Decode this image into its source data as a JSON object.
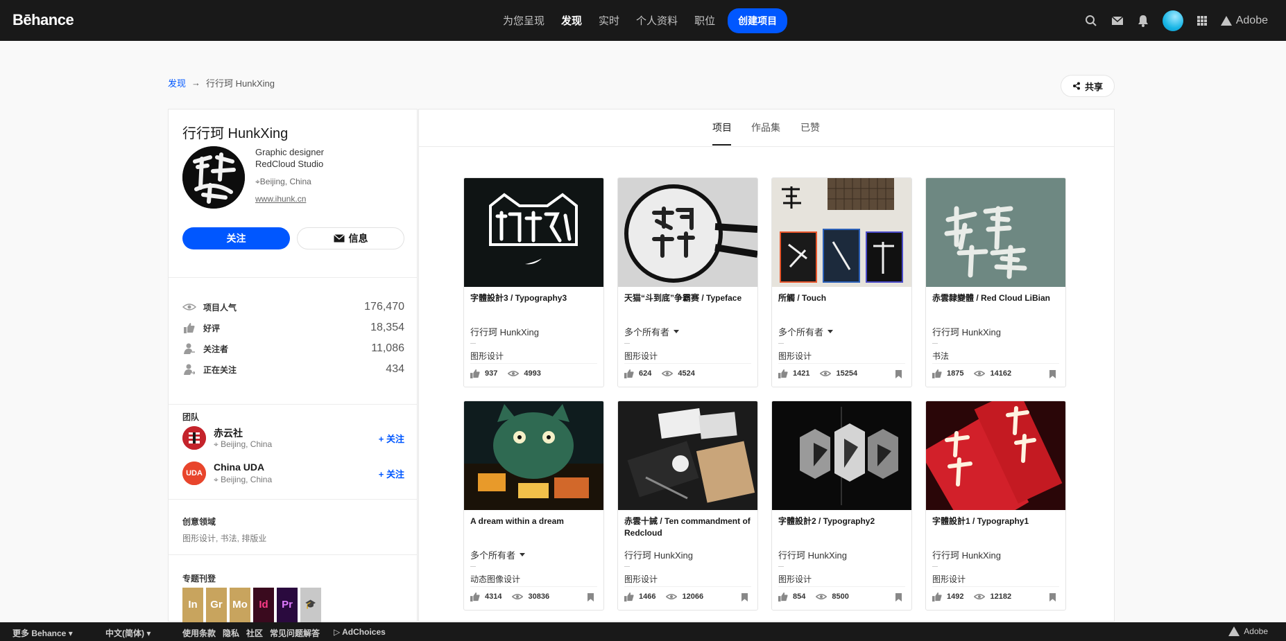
{
  "header": {
    "logo": "Bēhance",
    "nav": [
      "为您呈现",
      "发现",
      "实时",
      "个人资料",
      "职位"
    ],
    "active_nav": "发现",
    "create_label": "创建项目",
    "adobe_label": "Adobe"
  },
  "breadcrumb": {
    "root": "发现",
    "arrow": "→",
    "current": "行行珂 HunkXing"
  },
  "share_label": "共享",
  "profile": {
    "name": "行行珂 HunkXing",
    "occupation": "Graphic designer",
    "company": "RedCloud Studio",
    "location": "Beijing, China",
    "website": "www.ihunk.cn",
    "follow_label": "关注",
    "message_label": "信息"
  },
  "stats": [
    {
      "icon": "eye-icon",
      "label": "项目人气",
      "value": "176,470"
    },
    {
      "icon": "thumbs-up-icon",
      "label": "好评",
      "value": "18,354"
    },
    {
      "icon": "followers-icon",
      "label": "关注者",
      "value": "11,086"
    },
    {
      "icon": "following-icon",
      "label": "正在关注",
      "value": "434"
    }
  ],
  "team": {
    "title": "团队",
    "members": [
      {
        "name": "赤云社",
        "location": "Beijing, China",
        "follow": "+ 关注",
        "color": "#c4232b"
      },
      {
        "name": "China UDA",
        "location": "Beijing, China",
        "follow": "+ 关注",
        "color": "#e8452c"
      }
    ]
  },
  "creative_fields": {
    "title": "创意领域",
    "value": "图形设计, 书法, 排版业"
  },
  "featured": {
    "title": "专题刊登",
    "badges": [
      {
        "label": "In",
        "color": "#c8a45e"
      },
      {
        "label": "Gr",
        "color": "#c8a45e"
      },
      {
        "label": "Mo",
        "color": "#c8a45e"
      },
      {
        "label": "Id",
        "color": "#3a0a1e"
      },
      {
        "label": "Pr",
        "color": "#2a0a3e"
      },
      {
        "label": "🎓",
        "color": "#c8c8c8"
      }
    ]
  },
  "tabs": [
    "项目",
    "作品集",
    "已赞"
  ],
  "active_tab": "项目",
  "projects": [
    {
      "title": "字體設計3 / Typography3",
      "owner": "行行珂 HunkXing",
      "multi": false,
      "field": "图形设计",
      "likes": "937",
      "views": "4993"
    },
    {
      "title": "天猫“斗到底”争霸赛 / Typeface",
      "owner": "多个所有者",
      "multi": true,
      "field": "图形设计",
      "likes": "624",
      "views": "4524"
    },
    {
      "title": "所觸 / Touch",
      "owner": "多个所有者",
      "multi": true,
      "field": "图形设计",
      "likes": "1421",
      "views": "15254"
    },
    {
      "title": "赤雲隸變體 / Red Cloud LiBian",
      "owner": "行行珂 HunkXing",
      "multi": false,
      "field": "书法",
      "likes": "1875",
      "views": "14162"
    },
    {
      "title": "A dream within a dream",
      "owner": "多个所有者",
      "multi": true,
      "field": "动态图像设计",
      "likes": "4314",
      "views": "30836"
    },
    {
      "title": "赤雲十誡 / Ten commandment of Redcloud",
      "owner": "行行珂 HunkXing",
      "multi": false,
      "field": "图形设计",
      "likes": "1466",
      "views": "12066"
    },
    {
      "title": "字體設計2 / Typography2",
      "owner": "行行珂 HunkXing",
      "multi": false,
      "field": "图形设计",
      "likes": "854",
      "views": "8500"
    },
    {
      "title": "字體設計1 / Typography1",
      "owner": "行行珂 HunkXing",
      "multi": false,
      "field": "图形设计",
      "likes": "1492",
      "views": "12182"
    }
  ],
  "footer": {
    "more": "更多 Behance",
    "language": "中文(简体)",
    "terms": "使用条款",
    "privacy": "隐私",
    "community": "社区",
    "faq": "常见问题解答",
    "adchoices": "AdChoices",
    "adobe": "Adobe"
  },
  "colors": {
    "accent": "#0057ff",
    "topbar": "#191919"
  }
}
